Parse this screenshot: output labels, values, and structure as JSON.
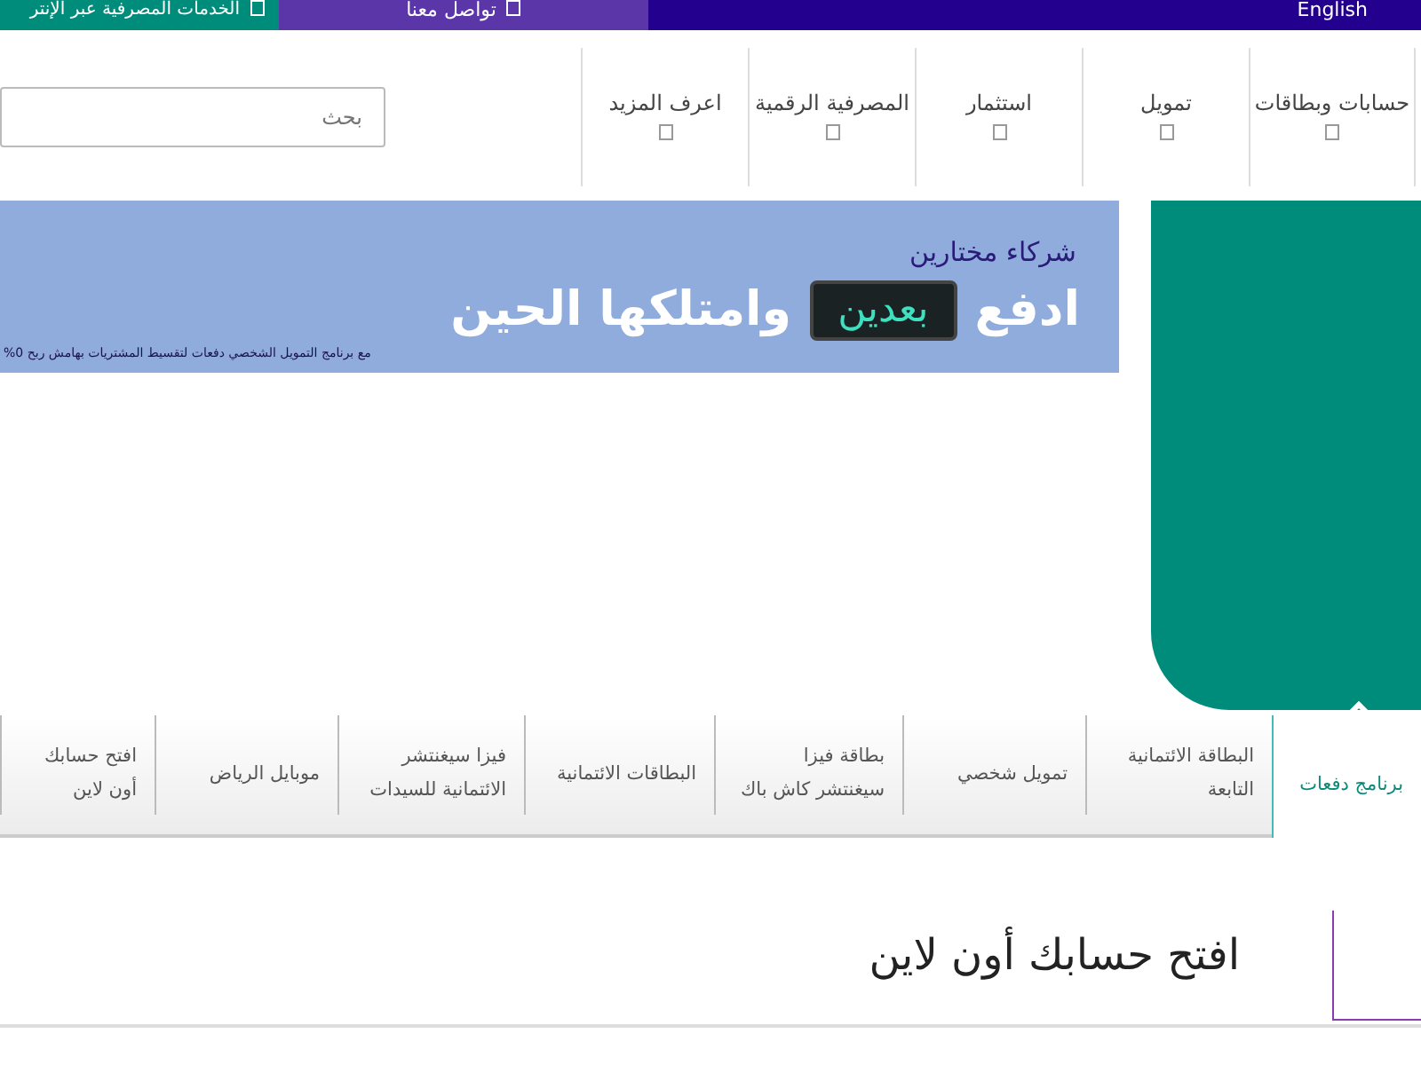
{
  "top_bar": [
    {
      "label": "English"
    },
    {
      "label": "تواصل معنا"
    },
    {
      "label": "الخدمات المصرفية عبر الإنتر"
    }
  ],
  "nav": {
    "items": [
      {
        "label": "حسابات وبطاقات"
      },
      {
        "label": "تمويل"
      },
      {
        "label": "استثمار"
      },
      {
        "label": "المصرفية الرقمية"
      },
      {
        "label": "اعرف المزيد"
      }
    ],
    "search": {
      "placeholder": "بحث"
    }
  },
  "banner": {
    "tagline": "شركاء مختارين",
    "headline_start": "ادفع",
    "display_text": "بعدين",
    "headline_end": "وامتلكها الحين",
    "subtext": "مع برنامج التمويل الشخصي دفعات لتقسيط المشتريات بهامش ربح 0%"
  },
  "tabs": [
    {
      "label": "برنامج دفعات",
      "selected": true
    },
    {
      "label": "البطاقة الائتمانية التابعة",
      "selected": false
    },
    {
      "label": "تمويل شخصي",
      "selected": false
    },
    {
      "label": "بطاقة فيزا سيغنتشر كاش باك",
      "selected": false
    },
    {
      "label": "البطاقات الائتمانية",
      "selected": false
    },
    {
      "label": "فيزا سيغنتشر الائتمانية للسيدات",
      "selected": false
    },
    {
      "label": "موبايل الرياض",
      "selected": false
    },
    {
      "label": "افتح حسابك أون لاين",
      "selected": false
    }
  ],
  "section": {
    "title": "افتح حسابك أون لاين"
  }
}
